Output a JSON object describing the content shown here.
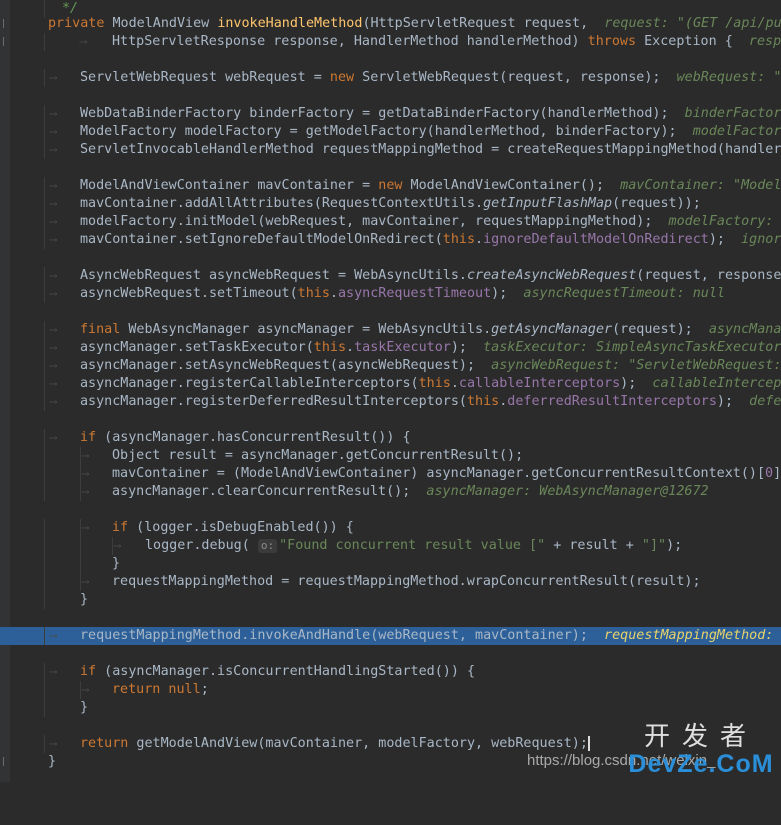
{
  "editor": {
    "language": "java",
    "theme_colors": {
      "background": "#2b2b2b",
      "keyword": "#cc7832",
      "method_declaration": "#ffc66d",
      "string": "#6a8759",
      "field": "#9876aa",
      "inline_hint": "#6a8759",
      "current_line": "#2d6099"
    },
    "lines": [
      {
        "text": "*/"
      },
      {
        "text": "private ModelAndView invokeHandleMethod(HttpServletRequest request,  request: \"(GET /api/pub"
      },
      {
        "text": "HttpServletResponse response, HandlerMethod handlerMethod) throws Exception {  respo"
      },
      {
        "text": "ServletWebRequest webRequest = new ServletWebRequest(request, response);  webRequest: \"S"
      },
      {
        "text": "WebDataBinderFactory binderFactory = getDataBinderFactory(handlerMethod);  binderFactory"
      },
      {
        "text": "ModelFactory modelFactory = getModelFactory(handlerMethod, binderFactory);  modelFactory"
      },
      {
        "text": "ServletInvocableHandlerMethod requestMappingMethod = createRequestMappingMethod(handlerM"
      },
      {
        "text": "ModelAndViewContainer mavContainer = new ModelAndViewContainer();  mavContainer: \"ModelA"
      },
      {
        "text": "mavContainer.addAllAttributes(RequestContextUtils.getInputFlashMap(request));"
      },
      {
        "text": "modelFactory.initModel(webRequest, mavContainer, requestMappingMethod);  modelFactory: M"
      },
      {
        "text": "mavContainer.setIgnoreDefaultModelOnRedirect(this.ignoreDefaultModelOnRedirect);  ignore"
      },
      {
        "text": "AsyncWebRequest asyncWebRequest = WebAsyncUtils.createAsyncWebRequest(request, response)"
      },
      {
        "text": "asyncWebRequest.setTimeout(this.asyncRequestTimeout);  asyncRequestTimeout: null"
      },
      {
        "text": "final WebAsyncManager asyncManager = WebAsyncUtils.getAsyncManager(request);  asyncManag"
      },
      {
        "text": "asyncManager.setTaskExecutor(this.taskExecutor);  taskExecutor: SimpleAsyncTaskExecutor@"
      },
      {
        "text": "asyncManager.setAsyncWebRequest(asyncWebRequest);  asyncWebRequest: \"ServletWebRequest: "
      },
      {
        "text": "asyncManager.registerCallableInterceptors(this.callableInterceptors);  callableIntercept"
      },
      {
        "text": "asyncManager.registerDeferredResultInterceptors(this.deferredResultInterceptors);  defer"
      },
      {
        "text": "if (asyncManager.hasConcurrentResult()) {"
      },
      {
        "text": "Object result = asyncManager.getConcurrentResult();"
      },
      {
        "text": "mavContainer = (ModelAndViewContainer) asyncManager.getConcurrentResultContext()[0];"
      },
      {
        "text": "asyncManager.clearConcurrentResult();  asyncManager: WebAsyncManager@12672"
      },
      {
        "text": "if (logger.isDebugEnabled()) {"
      },
      {
        "text": "logger.debug( o: \"Found concurrent result value [\" + result + \"]\");"
      },
      {
        "text": "}"
      },
      {
        "text": "requestMappingMethod = requestMappingMethod.wrapConcurrentResult(result);"
      },
      {
        "text": "}"
      },
      {
        "text": "requestMappingMethod.invokeAndHandle(webRequest, mavContainer);  requestMappingMethod: \""
      },
      {
        "text": "if (asyncManager.isConcurrentHandlingStarted()) {"
      },
      {
        "text": "return null;"
      },
      {
        "text": "}"
      },
      {
        "text": "return getModelAndView(mavContainer, modelFactory, webRequest);"
      },
      {
        "text": "}"
      }
    ]
  },
  "watermark": {
    "url_text": "https://blog.csdn.net/weixin_",
    "logo_cn": "开发者",
    "logo_en": "DevZe.CoM"
  }
}
